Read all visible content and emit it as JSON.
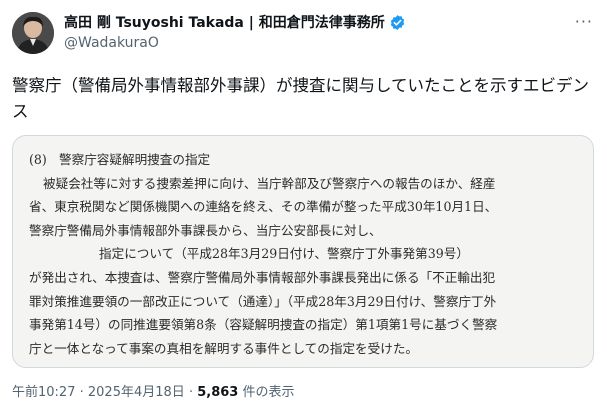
{
  "author": {
    "display_name": "高田 剛 Tsuyoshi Takada | 和田倉門法律事務所",
    "handle": "@WadakuraO"
  },
  "more_icon": "more-icon",
  "verified_icon": "verified-badge-icon",
  "post": {
    "text": "警察庁（警備局外事情報部外事課）が捜査に関与していたことを示すエビデンス"
  },
  "document": {
    "heading_number": "(8)",
    "heading_title": "警察庁容疑解明捜査の指定",
    "lines": [
      "被疑会社等に対する捜索差押に向け、当庁幹部及び警察庁への報告のほか、経産",
      "省、東京税関など関係機関への連絡を終え、その準備が整った平成30年10月1日、",
      "警察庁警備局外事情報部外事課長から、当庁公安部長に対し、",
      "指定について（平成28年3月29日付け、警察庁丁外事発第39号）",
      "が発出され、本捜査は、警察庁警備局外事情報部外事課長発出に係る「不正輸出犯",
      "罪対策推進要領の一部改正について（通達）」（平成28年3月29日付け、警察庁丁外",
      "事発第14号）の同推進要領第8条（容疑解明捜査の指定）第1項第1号に基づく警察",
      "庁と一体となって事案の真相を解明する事件としての指定を受けた。"
    ]
  },
  "meta": {
    "time": "午前10:27",
    "date": "2025年4月18日",
    "views_count": "5,863",
    "views_label": "件の表示",
    "separator": "·"
  }
}
